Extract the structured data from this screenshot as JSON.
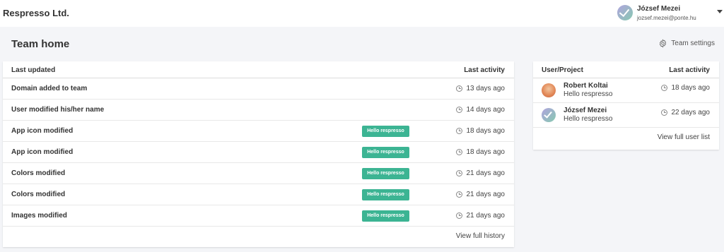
{
  "header": {
    "company": "Respresso Ltd.",
    "user": {
      "name": "József Mezei",
      "email": "jozsef.mezei@ponte.hu"
    }
  },
  "page": {
    "title": "Team home",
    "settings_label": "Team settings"
  },
  "history": {
    "col_left": "Last updated",
    "col_right": "Last activity",
    "rows": [
      {
        "title": "Domain added to team",
        "project": "",
        "time": "13 days ago"
      },
      {
        "title": "User modified his/her name",
        "project": "",
        "time": "14 days ago"
      },
      {
        "title": "App icon modified",
        "project": "Hello respresso",
        "time": "18 days ago"
      },
      {
        "title": "App icon modified",
        "project": "Hello respresso",
        "time": "18 days ago"
      },
      {
        "title": "Colors modified",
        "project": "Hello respresso",
        "time": "21 days ago"
      },
      {
        "title": "Colors modified",
        "project": "Hello respresso",
        "time": "21 days ago"
      },
      {
        "title": "Images modified",
        "project": "Hello respresso",
        "time": "21 days ago"
      }
    ],
    "footer_link": "View full history"
  },
  "users": {
    "col_left": "User/Project",
    "col_right": "Last activity",
    "rows": [
      {
        "name": "Robert Koltai",
        "project": "Hello respresso",
        "time": "18 days ago"
      },
      {
        "name": "József Mezei",
        "project": "Hello respresso",
        "time": "22 days ago"
      }
    ],
    "footer_link": "View full user list"
  },
  "colors": {
    "badge": "#3cb493",
    "background": "#f4f5f8"
  },
  "icons": [
    "gear-icon",
    "clock-icon",
    "chevron-down-icon",
    "check-icon"
  ]
}
